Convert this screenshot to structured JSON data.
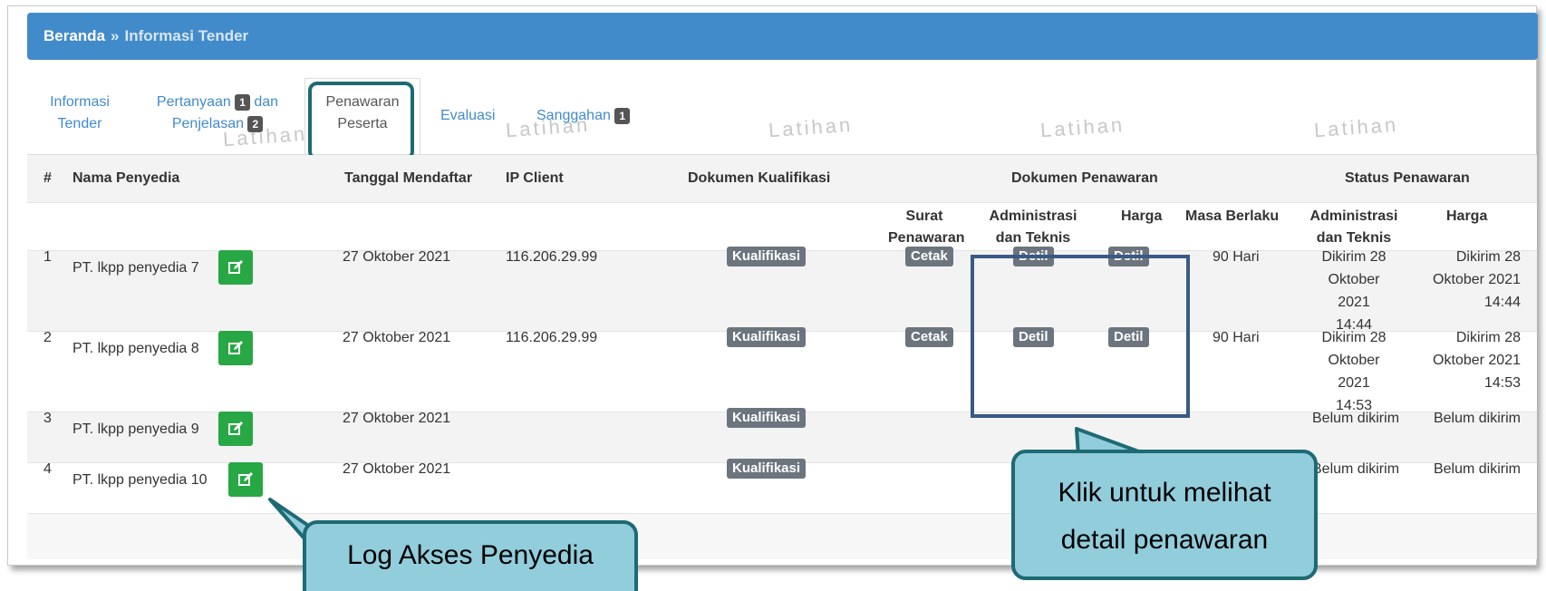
{
  "breadcrumb": {
    "home": "Beranda",
    "separator": "»",
    "current": "Informasi Tender"
  },
  "tabs": {
    "info": [
      "Informasi",
      "Tender"
    ],
    "pertanyaan": {
      "line1": "Pertanyaan",
      "badge1": "1",
      "line1b": "dan",
      "line2": "Penjelasan",
      "badge2": "2"
    },
    "penawaran": [
      "Penawaran",
      "Peserta"
    ],
    "evaluasi": "Evaluasi",
    "sanggahan": {
      "label": "Sanggahan",
      "badge": "1"
    }
  },
  "watermark": "Latihan",
  "table": {
    "headers": {
      "no": "#",
      "nama": "Nama Penyedia",
      "tanggal": "Tanggal Mendaftar",
      "ip": "IP Client",
      "kualifikasi": "Dokumen Kualifikasi",
      "penawaran": "Dokumen Penawaran",
      "status": "Status Penawaran"
    },
    "subheaders": {
      "surat": [
        "Surat",
        "Penawaran"
      ],
      "admin": [
        "Administrasi",
        "dan Teknis"
      ],
      "harga": "Harga",
      "masa": "Masa Berlaku",
      "status_admin": [
        "Administrasi",
        "dan Teknis"
      ],
      "status_harga": "Harga"
    },
    "rows": [
      {
        "no": "1",
        "nama": "PT. lkpp penyedia 7",
        "tanggal": "27 Oktober 2021",
        "ip": "116.206.29.99",
        "kualifikasi": "Kualifikasi",
        "surat": "Cetak",
        "admin": "Detil",
        "harga": "Detil",
        "masa": "90 Hari",
        "status_admin": [
          "Dikirim 28",
          "Oktober 2021",
          "14:44"
        ],
        "status_harga": [
          "Dikirim 28",
          "Oktober 2021",
          "14:44"
        ]
      },
      {
        "no": "2",
        "nama": "PT. lkpp penyedia 8",
        "tanggal": "27 Oktober 2021",
        "ip": "116.206.29.99",
        "kualifikasi": "Kualifikasi",
        "surat": "Cetak",
        "admin": "Detil",
        "harga": "Detil",
        "masa": "90 Hari",
        "status_admin": [
          "Dikirim 28",
          "Oktober 2021",
          "14:53"
        ],
        "status_harga": [
          "Dikirim 28",
          "Oktober 2021",
          "14:53"
        ]
      },
      {
        "no": "3",
        "nama": "PT. lkpp penyedia 9",
        "tanggal": "27 Oktober 2021",
        "ip": "",
        "kualifikasi": "Kualifikasi",
        "status_admin": "Belum dikirim",
        "status_harga": "Belum dikirim"
      },
      {
        "no": "4",
        "nama": "PT. lkpp penyedia 10",
        "tanggal": "27 Oktober 2021",
        "ip": "",
        "kualifikasi": "Kualifikasi",
        "status_admin": "Belum dikirim",
        "status_harga": "Belum dikirim"
      }
    ]
  },
  "callouts": {
    "log": "Log Akses Penyedia",
    "detail": [
      "Klik untuk melihat",
      "detail penawaran"
    ]
  },
  "colors": {
    "header": "#428bca",
    "edit_button": "#28a745",
    "label": "#6c757d",
    "callout_fill": "#92cddc",
    "callout_border": "#1d6a74",
    "highlight_border": "#3a5a85"
  }
}
